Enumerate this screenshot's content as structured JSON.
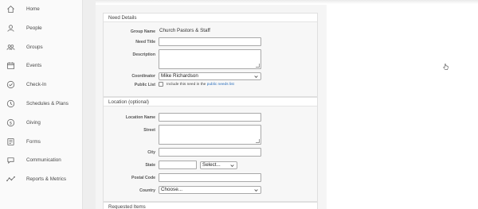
{
  "sidebar": {
    "items": [
      {
        "label": "Home",
        "icon": "home-icon"
      },
      {
        "label": "People",
        "icon": "person-icon"
      },
      {
        "label": "Groups",
        "icon": "groups-icon"
      },
      {
        "label": "Events",
        "icon": "calendar-icon"
      },
      {
        "label": "Check-In",
        "icon": "check-circle-icon"
      },
      {
        "label": "Schedules & Plans",
        "icon": "clock-icon"
      },
      {
        "label": "Giving",
        "icon": "dollar-icon"
      },
      {
        "label": "Forms",
        "icon": "forms-icon"
      },
      {
        "label": "Communication",
        "icon": "chat-icon"
      },
      {
        "label": "Reports & Metrics",
        "icon": "metrics-icon"
      }
    ]
  },
  "need_details": {
    "header": "Need Details",
    "group_name_label": "Group Name",
    "group_name_value": "Church Pastors & Staff",
    "need_title_label": "Need Title",
    "need_title_value": "",
    "description_label": "Description",
    "description_value": "",
    "coordinator_label": "Coordinator",
    "coordinator_value": "Mike Richardson",
    "public_list_label": "Public List",
    "public_list_text": "Include this need in the",
    "public_list_link": "public needs list"
  },
  "location": {
    "header": "Location (optional)",
    "location_name_label": "Location Name",
    "street_label": "Street",
    "city_label": "City",
    "state_label": "State",
    "state_select": "Select...",
    "postal_code_label": "Postal Code",
    "country_label": "Country",
    "country_select": "Choose..."
  },
  "requested_items": {
    "header": "Requested Items"
  },
  "colors": {
    "link": "#2a6ebb",
    "sidebar_bg": "#fafafa",
    "panel_bg": "#f7f7f7"
  }
}
